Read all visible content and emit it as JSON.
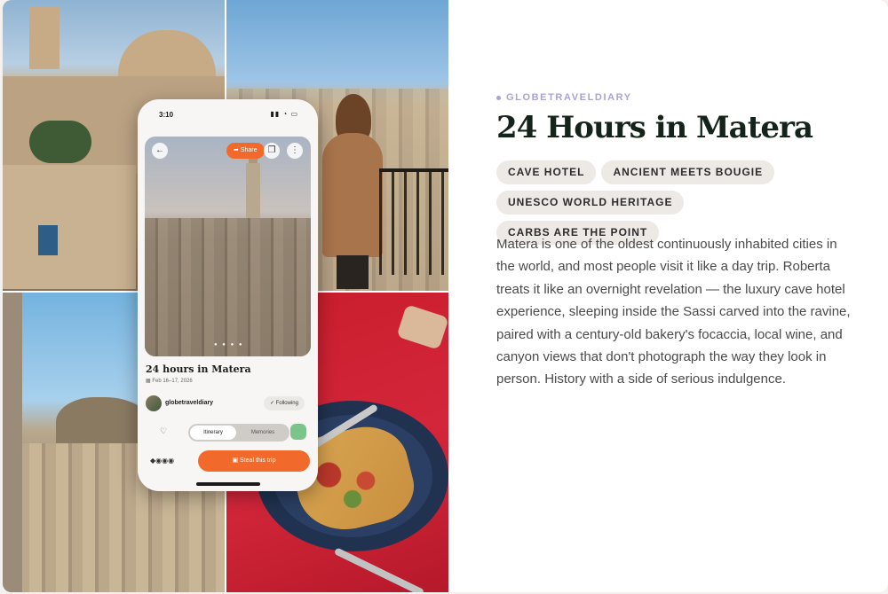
{
  "phone": {
    "time": "3:10",
    "status_icons": "▮▮ ◔ ▭",
    "share_label": "Share",
    "title": "24 hours in Matera",
    "date": "Feb 16–17, 2026",
    "username": "globetraveldiary",
    "following_label": "Following",
    "tabs": [
      "Itinerary",
      "Memories"
    ],
    "steal_label": "Steal this trip"
  },
  "article": {
    "eyebrow": "GLOBETRAVELDIARY",
    "title": "24 Hours in Matera",
    "tags": [
      "CAVE HOTEL",
      "ANCIENT MEETS BOUGIE",
      "UNESCO WORLD HERITAGE",
      "CARBS ARE THE POINT"
    ],
    "description": "Matera is one of the oldest continuously inhabited cities in the world, and most people visit it like a day trip. Roberta treats it like an overnight revelation — the luxury cave hotel experience, sleeping inside the Sassi carved into the ravine, paired with a century-old bakery's focaccia, local wine, and canyon views that don't photograph the way they look in person. History with a side of serious indulgence."
  },
  "colors": {
    "accent_orange": "#f26a2b",
    "eyebrow_purple": "#a9a4d4",
    "title_green": "#15241b",
    "tag_bg": "#ede9e4"
  },
  "icons": [
    "back-arrow-icon",
    "share-icon",
    "copy-icon",
    "more-icon",
    "calendar-icon",
    "heart-icon",
    "check-icon"
  ]
}
